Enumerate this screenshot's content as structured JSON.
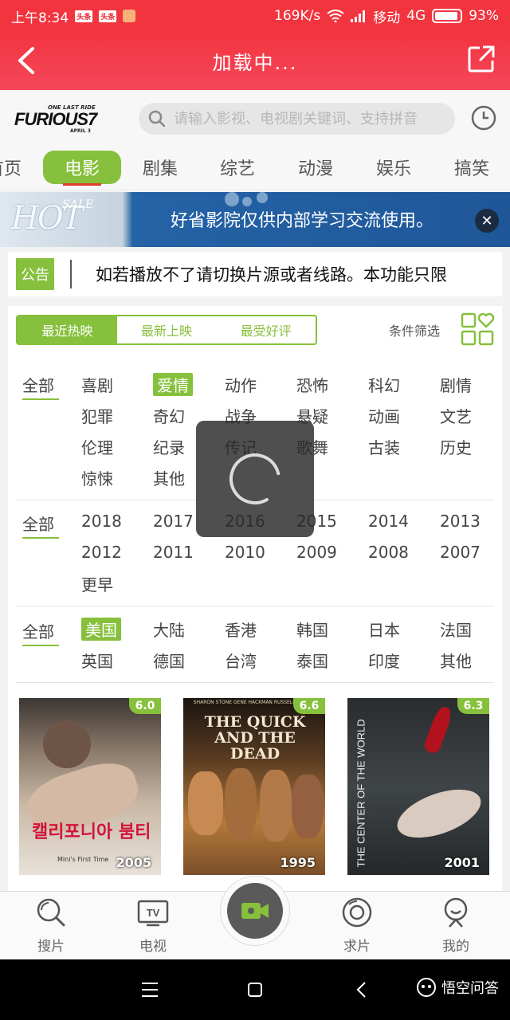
{
  "status_bar": {
    "time": "上午8:34",
    "badge1": "头条",
    "badge2": "头条",
    "speed": "169K/s",
    "carrier": "移动",
    "network": "4G",
    "battery": "93%"
  },
  "header": {
    "title": "加载中..."
  },
  "logo": {
    "top": "ONE LAST RIDE",
    "main": "FURIOUS7",
    "sub": "APRIL 3"
  },
  "search": {
    "placeholder": "请输入影视、电视剧关键词、支持拼音"
  },
  "category_tabs": [
    "首页",
    "电影",
    "剧集",
    "综艺",
    "动漫",
    "娱乐",
    "搞笑"
  ],
  "banner": {
    "sale": "SALE",
    "hot": "HOT",
    "text": "好省影院仅供内部学习交流使用。",
    "close": "✕"
  },
  "notice": {
    "badge": "公告",
    "text": "如若播放不了请切换片源或者线路。本功能只限"
  },
  "sort_tabs": [
    "最近热映",
    "最新上映",
    "最受好评"
  ],
  "filter_label": "条件筛选",
  "genre": {
    "all": "全部",
    "items": [
      "喜剧",
      "爱情",
      "动作",
      "恐怖",
      "科幻",
      "剧情",
      "犯罪",
      "奇幻",
      "战争",
      "悬疑",
      "动画",
      "文艺",
      "伦理",
      "纪录",
      "传记",
      "歌舞",
      "古装",
      "历史",
      "惊悚",
      "其他"
    ],
    "selected": "爱情"
  },
  "year": {
    "all": "全部",
    "items": [
      "2018",
      "2017",
      "2016",
      "2015",
      "2014",
      "2013",
      "2012",
      "2011",
      "2010",
      "2009",
      "2008",
      "2007",
      "更早"
    ]
  },
  "region": {
    "all": "全部",
    "items": [
      "美国",
      "大陆",
      "香港",
      "韩国",
      "日本",
      "法国",
      "英国",
      "德国",
      "台湾",
      "泰国",
      "印度",
      "其他"
    ],
    "selected": "美国"
  },
  "posters": [
    {
      "rating": "6.0",
      "year": "2005",
      "title": "캘리포니아 붐티",
      "subtitle": "Mini's First Time"
    },
    {
      "rating": "6.6",
      "year": "1995",
      "title": "THE QUICK AND THE DEAD",
      "subtitle": "SHARON STONE  GENE HACKMAN  RUSSELL CROWE"
    },
    {
      "rating": "6.3",
      "year": "2001",
      "title": "THE CENTER OF THE WORLD",
      "subtitle": ""
    }
  ],
  "bottom_nav": [
    "搜片",
    "电视",
    "求片",
    "我的"
  ],
  "tv_label": "TV",
  "watermark": "悟空问答"
}
